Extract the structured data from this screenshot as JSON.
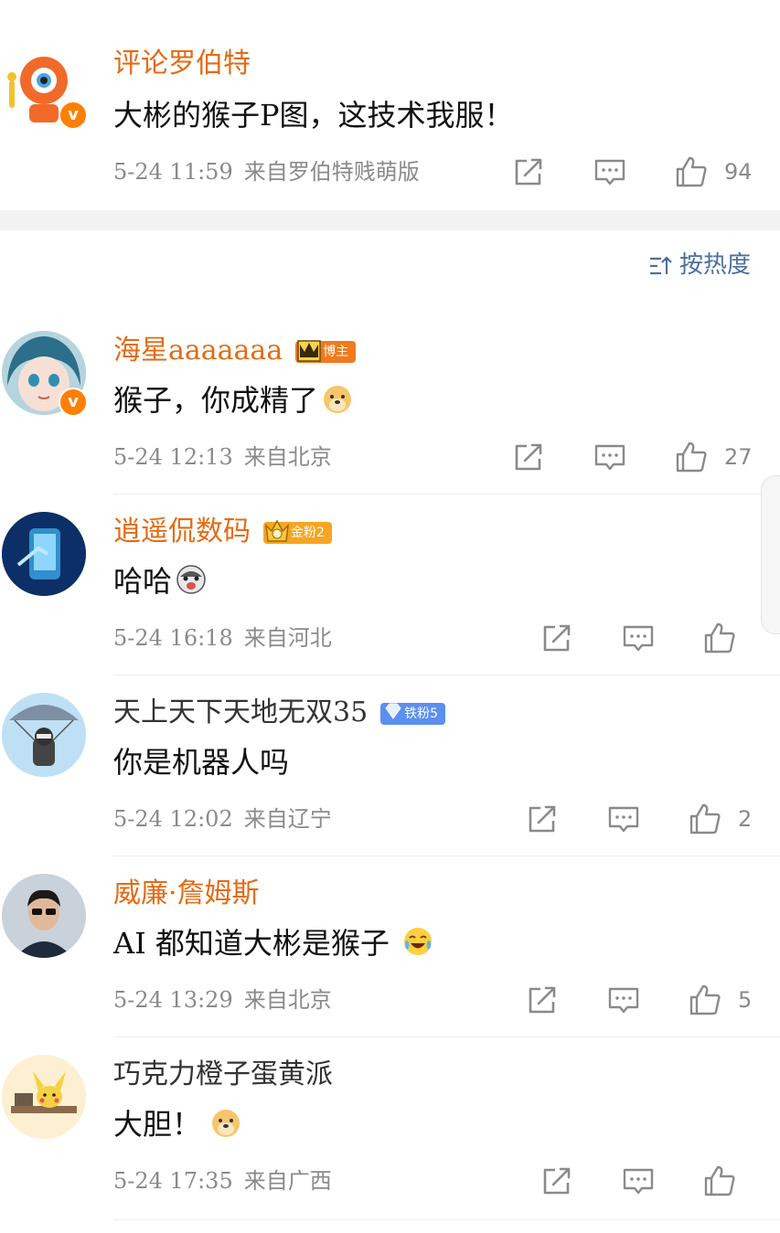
{
  "top_comment": {
    "name": "评论罗伯特",
    "text": "大彬的猴子P图，这技术我服！",
    "time": "5-24 11:59",
    "source": "来自罗伯特贱萌版",
    "likes": "94"
  },
  "sort": {
    "label": "按热度"
  },
  "comments": [
    {
      "name": "海星aaaaaaa",
      "badge": "博主",
      "text": "猴子，你成精了",
      "time": "5-24 12:13",
      "source": "来自北京",
      "likes": "27"
    },
    {
      "name": "逍遥侃数码",
      "badge": "金粉2",
      "text": "哈哈",
      "time": "5-24 16:18",
      "source": "来自河北",
      "likes": ""
    },
    {
      "name": "天上天下天地无双35",
      "badge": "铁粉5",
      "text": "你是机器人吗",
      "time": "5-24 12:02",
      "source": "来自辽宁",
      "likes": "2"
    },
    {
      "name": "威廉·詹姆斯",
      "badge": "",
      "text": "AI 都知道大彬是猴子",
      "time": "5-24 13:29",
      "source": "来自北京",
      "likes": "5"
    },
    {
      "name": "巧克力橙子蛋黄派",
      "badge": "",
      "text": "大胆！",
      "time": "5-24 17:35",
      "source": "来自广西",
      "likes": ""
    }
  ],
  "colors": {
    "orange_name": "#e36b15",
    "sort_blue": "#4c6f9c",
    "meta_gray": "#8a8a8a"
  },
  "icons": [
    "share-icon",
    "comment-icon",
    "like-icon",
    "sort-icon"
  ]
}
